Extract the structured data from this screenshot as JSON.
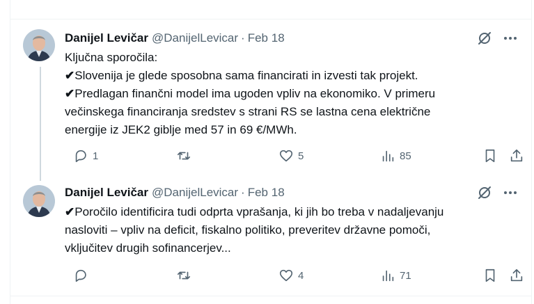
{
  "tweets": [
    {
      "author": "Danijel Levičar",
      "handle": "@DanijelLevicar",
      "separator": "·",
      "date": "Feb 18",
      "lines": [
        {
          "check": "",
          "text": "Ključna sporočila:"
        },
        {
          "check": "✔",
          "text": "Slovenija je glede sposobna sama financirati in izvesti tak projekt."
        },
        {
          "check": "✔",
          "text": "Predlagan finančni model ima ugoden vpliv na ekonomiko. V primeru"
        },
        {
          "check": "",
          "text": "večinskega financiranja sredstev s strani RS se lastna cena električne"
        },
        {
          "check": "",
          "text": "energije iz JEK2 giblje med 57 in 69 €/MWh."
        }
      ],
      "stats": {
        "replies": "1",
        "retweets": "",
        "likes": "5",
        "views": "85"
      }
    },
    {
      "author": "Danijel Levičar",
      "handle": "@DanijelLevicar",
      "separator": "·",
      "date": "Feb 18",
      "lines": [
        {
          "check": "✔",
          "text": "Poročilo identificira tudi odprta vprašanja, ki jih bo treba v nadaljevanju"
        },
        {
          "check": "",
          "text": "nasloviti – vpliv na deficit, fiskalno politiko, preveritev državne pomoči,"
        },
        {
          "check": "",
          "text": "vključitev drugih sofinancerjev..."
        }
      ],
      "stats": {
        "replies": "",
        "retweets": "",
        "likes": "4",
        "views": "71"
      }
    }
  ],
  "icons": {
    "reply": "reply-icon",
    "retweet": "retweet-icon",
    "like": "heart-icon",
    "views": "views-icon",
    "bookmark": "bookmark-icon",
    "share": "share-icon",
    "grok": "grok-icon",
    "more": "more-icon"
  },
  "colors": {
    "text": "#0f1419",
    "muted": "#536471",
    "border": "#eff3f4",
    "thread": "#cfd9de"
  }
}
